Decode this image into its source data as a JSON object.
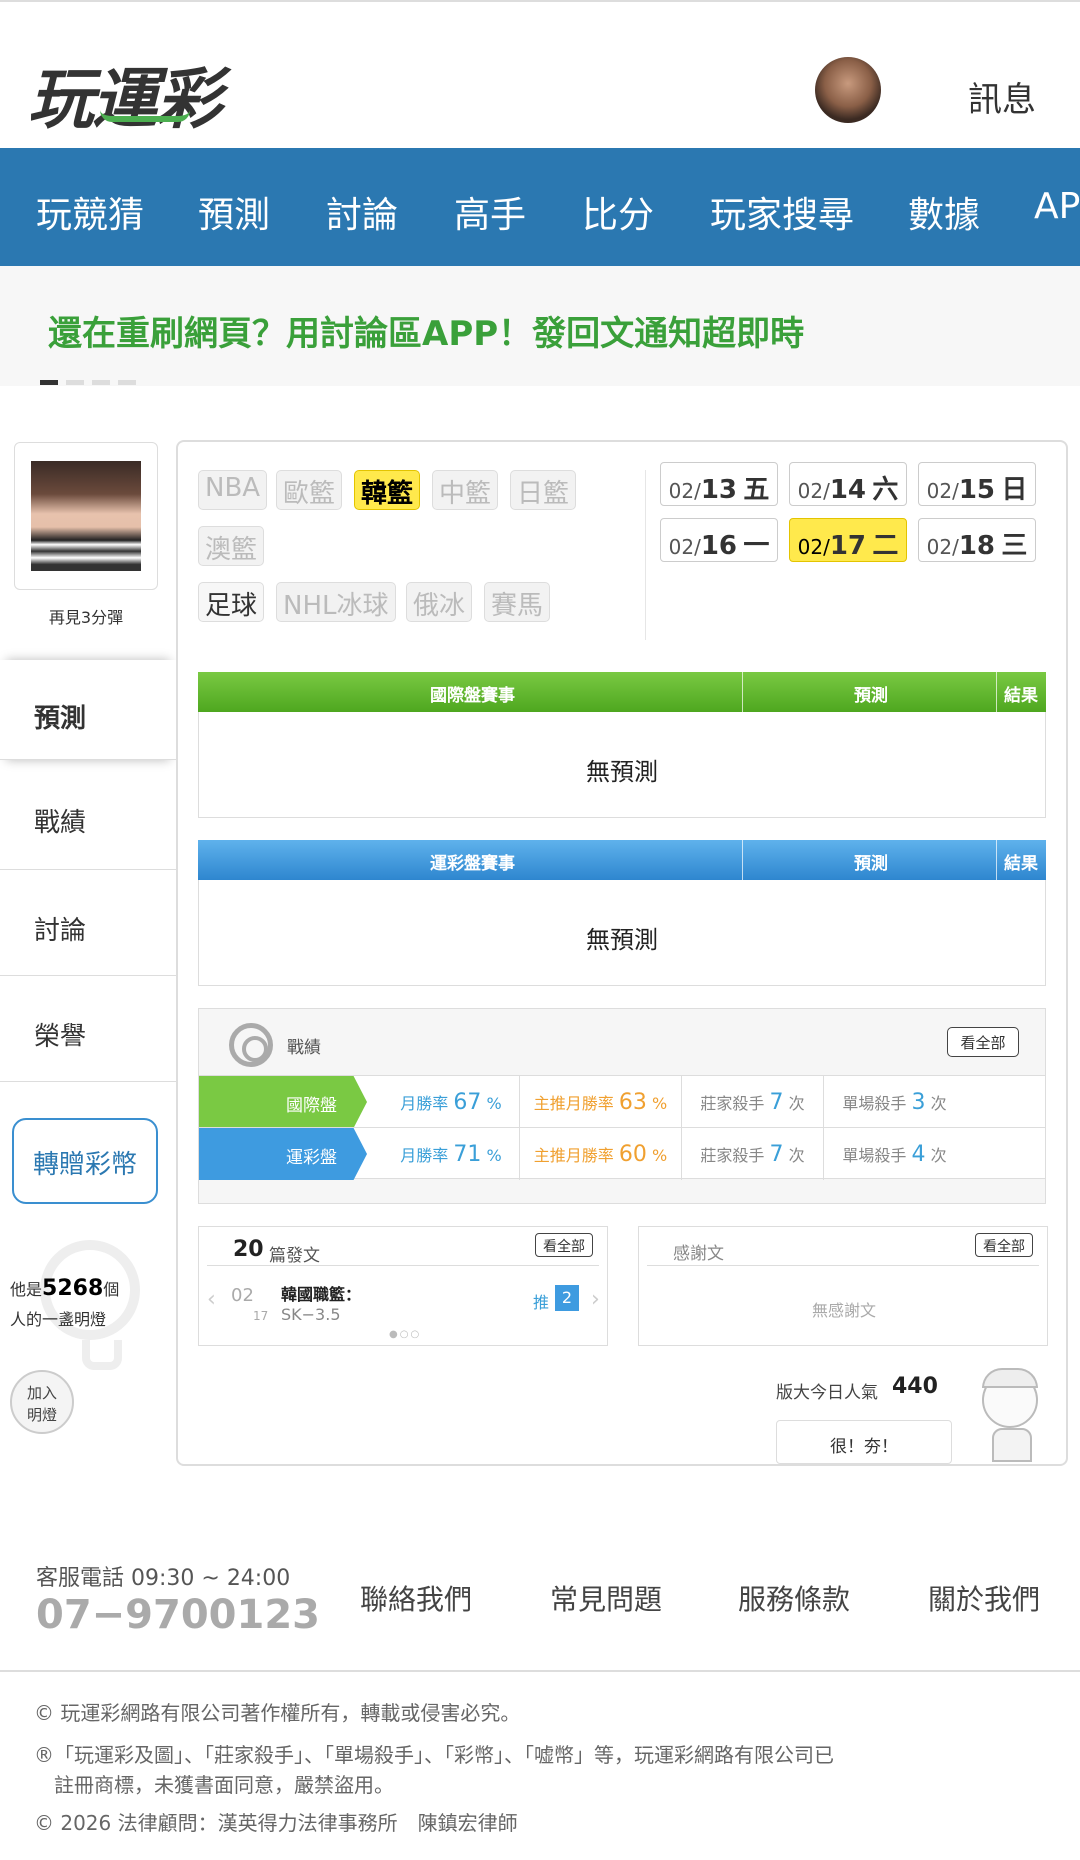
{
  "header": {
    "logo_text": "玩運彩",
    "avatar_icon": "user-avatar",
    "message_label": "訊息"
  },
  "nav": {
    "items": [
      "玩競猜",
      "預測",
      "討論",
      "高手",
      "比分",
      "玩家搜尋",
      "數據",
      "AP"
    ]
  },
  "banner": {
    "text": "還在重刷網頁？用討論區APP！發回文通知超即時",
    "slides": 4,
    "active_slide": 0
  },
  "sidebar": {
    "profile_name": "再見3分彈",
    "items": [
      "預測",
      "戰績",
      "討論",
      "榮譽"
    ],
    "active_item": "預測",
    "gift_button": "轉贈彩幣",
    "bulb_prefix": "他是",
    "bulb_count": "5268",
    "bulb_suffix": "個",
    "bulb_line2": "人的一盞明燈",
    "join_button_line1": "加入",
    "join_button_line2": "明燈"
  },
  "leagues": {
    "items": [
      "NBA",
      "歐籃",
      "韓籃",
      "中籃",
      "日籃",
      "澳籃",
      "足球",
      "NHL冰球",
      "俄冰",
      "賽馬"
    ],
    "active": "韓籃",
    "enabled": [
      "韓籃",
      "足球"
    ]
  },
  "dates": [
    {
      "month": "02/",
      "day": "13",
      "weekday": "五"
    },
    {
      "month": "02/",
      "day": "14",
      "weekday": "六"
    },
    {
      "month": "02/",
      "day": "15",
      "weekday": "日"
    },
    {
      "month": "02/",
      "day": "16",
      "weekday": "一"
    },
    {
      "month": "02/",
      "day": "17",
      "weekday": "二"
    },
    {
      "month": "02/",
      "day": "18",
      "weekday": "三"
    }
  ],
  "active_date_index": 4,
  "international_table": {
    "header_game": "國際盤賽事",
    "header_predict": "預測",
    "header_result": "結果",
    "empty_text": "無預測"
  },
  "sports_lottery_table": {
    "header_game": "運彩盤賽事",
    "header_predict": "預測",
    "header_result": "結果",
    "empty_text": "無預測"
  },
  "record": {
    "title": "戰績",
    "view_all": "看全部",
    "rows": [
      {
        "label": "國際盤",
        "month_win_label": "月勝率",
        "month_win_value": "67",
        "month_win_unit": "%",
        "main_win_label": "主推月勝率",
        "main_win_value": "63",
        "main_win_unit": "%",
        "banker_label": "莊家殺手",
        "banker_value": "7",
        "banker_unit": "次",
        "single_label": "單場殺手",
        "single_value": "3",
        "single_unit": "次"
      },
      {
        "label": "運彩盤",
        "month_win_label": "月勝率",
        "month_win_value": "71",
        "month_win_unit": "%",
        "main_win_label": "主推月勝率",
        "main_win_value": "60",
        "main_win_unit": "%",
        "banker_label": "莊家殺手",
        "banker_value": "7",
        "banker_unit": "次",
        "single_label": "單場殺手",
        "single_value": "4",
        "single_unit": "次"
      }
    ]
  },
  "posts": {
    "count": "20",
    "count_label": "篇發文",
    "view_all": "看全部",
    "latest": {
      "date_month": "02",
      "date_day": "17",
      "title": "韓國職籃：",
      "subtitle": "SK−3.5",
      "push_label": "推",
      "push_count": "2"
    },
    "dots": "●○○"
  },
  "thanks": {
    "title": "感謝文",
    "view_all": "看全部",
    "empty_text": "無感謝文"
  },
  "popularity": {
    "label": "版大今日人氣",
    "value": "440",
    "button": "很！夯！"
  },
  "footer": {
    "hours_label": "客服電話 09:30 ~ 24:00",
    "phone": "07−9700123",
    "links": [
      "聯絡我們",
      "常見問題",
      "服務條款",
      "關於我們"
    ],
    "copyright": "© 玩運彩網路有限公司著作權所有，轉載或侵害必究。",
    "trademark_line1": "®「玩運彩及圖」、「莊家殺手」、「單場殺手」、「彩幣」、「嘘幣」等，玩運彩網路有限公司已",
    "trademark_line2": "　註冊商標，未獲書面同意，嚴禁盜用。",
    "legal": "© 2026 法律顧問：漢英得力法律事務所　陳鎮宏律師"
  },
  "colors": {
    "nav_blue": "#2b78b1",
    "banner_green": "#3aa03a",
    "intl_green": "#7ac943",
    "lottery_blue": "#3e9be0",
    "highlight_yellow": "#ffe94c"
  }
}
